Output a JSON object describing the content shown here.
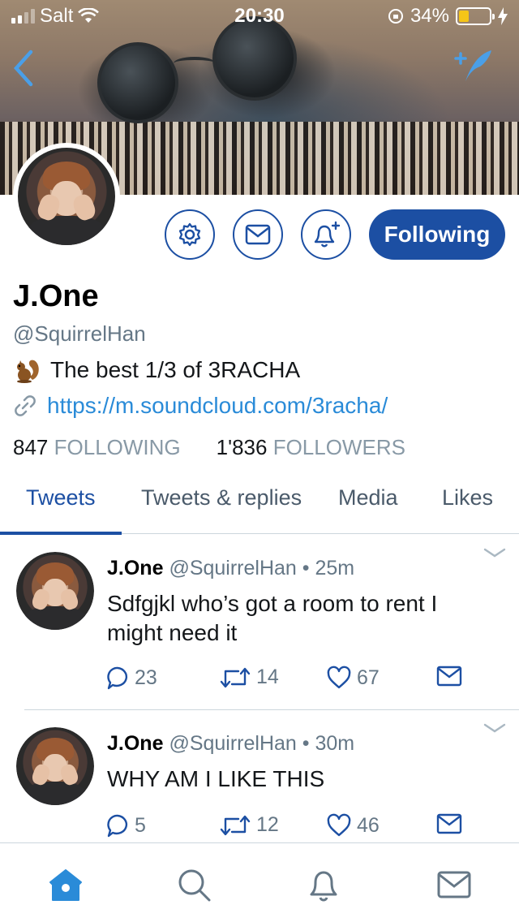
{
  "status_bar": {
    "carrier": "Salt",
    "time": "20:30",
    "battery": "34%",
    "battery_level": 0.34
  },
  "profile": {
    "name": "J.One",
    "handle": "@SquirrelHan",
    "bio": "The best 1/3 of 3RACHA",
    "link": "https://m.soundcloud.com/3racha/",
    "following_count": "847",
    "following_label": "FOLLOWING",
    "followers_count": "1'836",
    "followers_label": "FOLLOWERS",
    "follow_button": "Following"
  },
  "tabs": [
    {
      "label": "Tweets",
      "active": true
    },
    {
      "label": "Tweets & replies",
      "active": false
    },
    {
      "label": "Media",
      "active": false
    },
    {
      "label": "Likes",
      "active": false
    }
  ],
  "tweets": [
    {
      "name": "J.One",
      "handle": "@SquirrelHan",
      "time": "• 25m",
      "text": "Sdfgjkl who’s got a room to rent I might need it",
      "replies": "23",
      "retweets": "14",
      "likes": "67"
    },
    {
      "name": "J.One",
      "handle": "@SquirrelHan",
      "time": "• 30m",
      "text": "WHY AM I LIKE THIS",
      "replies": "5",
      "retweets": "12",
      "likes": "46"
    }
  ],
  "colors": {
    "accent": "#1c4fa3",
    "link": "#2a8bd8",
    "muted": "#657786"
  },
  "icons": [
    "back-icon",
    "compose-tweet-icon",
    "gear-icon",
    "envelope-icon",
    "bell-plus-icon",
    "squirrel-emoji-icon",
    "link-icon",
    "reply-icon",
    "retweet-icon",
    "heart-icon",
    "home-icon",
    "search-icon",
    "bell-icon"
  ]
}
